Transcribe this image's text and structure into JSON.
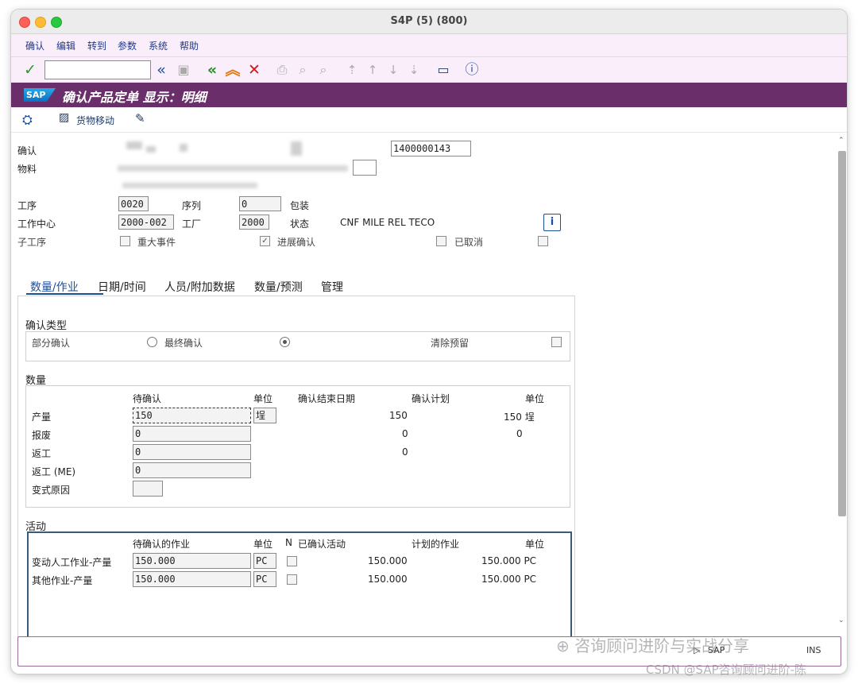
{
  "window": {
    "title": "S4P (5) (800)"
  },
  "menu": [
    "确认",
    "编辑",
    "转到",
    "参数",
    "系统",
    "帮助"
  ],
  "header": {
    "logo": "SAP",
    "title": "确认产品定单 显示：明细"
  },
  "app_toolbar": {
    "goods_movement": "货物移动"
  },
  "form": {
    "confirmation_label": "确认",
    "confirmation_number": "1400000143",
    "material_label": "物料",
    "operation_label": "工序",
    "operation_value": "0020",
    "sequence_label": "序列",
    "sequence_value": "0",
    "packaging_label": "包装",
    "workcenter_label": "工作中心",
    "workcenter_value": "2000-002",
    "plant_label": "工厂",
    "plant_value": "2000",
    "status_label": "状态",
    "status_value": "CNF MILE REL TECO",
    "suboperation_label": "子工序",
    "milestone_label": "重大事件",
    "progress_label": "进展确认",
    "cancelled_label": "已取消"
  },
  "tabs": [
    "数量/作业",
    "日期/时间",
    "人员/附加数据",
    "数量/预测",
    "管理"
  ],
  "confirmation_type": {
    "title": "确认类型",
    "partial": "部分确认",
    "final": "最终确认",
    "clear_reservation": "清除预留"
  },
  "quantities": {
    "title": "数量",
    "col_to_confirm": "待确认",
    "col_unit": "单位",
    "col_end_date": "确认结束日期",
    "col_plan": "确认计划",
    "col_unit2": "单位",
    "rows": [
      {
        "label": "产量",
        "value": "150",
        "unit": "埕",
        "confirmed": "150",
        "plan": "150 埕"
      },
      {
        "label": "报废",
        "value": "0",
        "unit": "",
        "confirmed": "0",
        "plan": "0"
      },
      {
        "label": "返工",
        "value": "0",
        "unit": "",
        "confirmed": "0",
        "plan": ""
      },
      {
        "label": "返工 (ME)",
        "value": "0",
        "unit": "",
        "confirmed": "",
        "plan": ""
      },
      {
        "label": "变式原因",
        "value": "",
        "unit": "",
        "confirmed": "",
        "plan": ""
      }
    ]
  },
  "activities": {
    "title": "活动",
    "col_to_confirm": "待确认的作业",
    "col_unit": "单位",
    "col_n": "N",
    "col_confirmed": "已确认活动",
    "col_planned": "计划的作业",
    "col_unit2": "单位",
    "rows": [
      {
        "label": "变动人工作业-产量",
        "value": "150.000",
        "unit": "PC",
        "confirmed": "150.000",
        "planned": "150.000 PC"
      },
      {
        "label": "其他作业-产量",
        "value": "150.000",
        "unit": "PC",
        "confirmed": "150.000",
        "planned": "150.000 PC"
      }
    ]
  },
  "watermark": {
    "line1": "咨询顾问进阶与实战分享",
    "line2": "CSDN @SAP咨询顾问进阶-陈"
  },
  "status_bar": {
    "system": "SAP",
    "mode": "INS"
  }
}
